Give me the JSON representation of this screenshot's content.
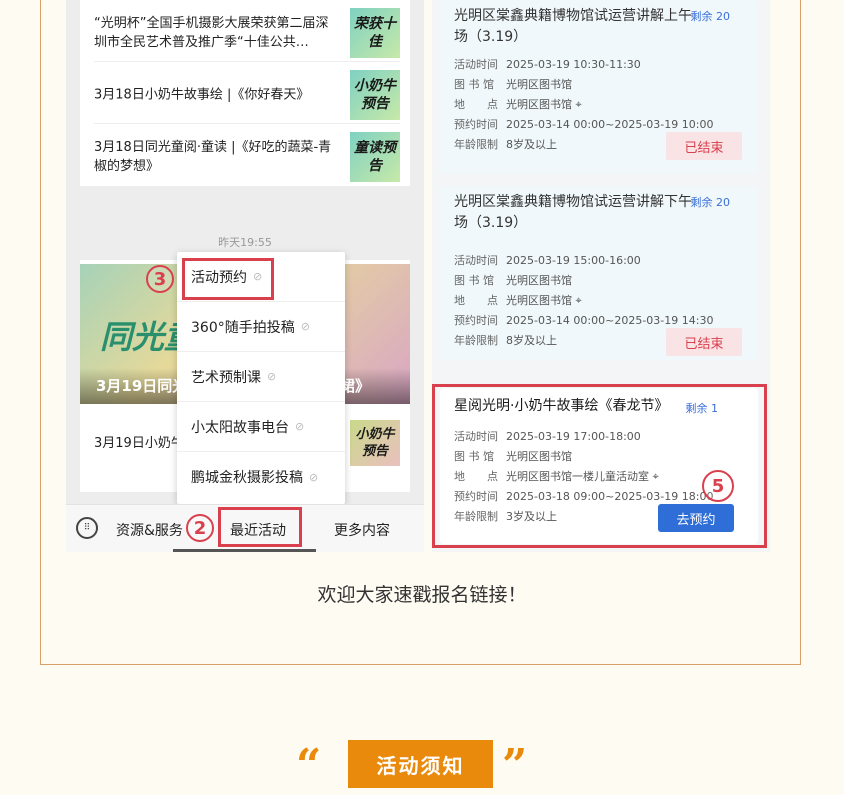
{
  "left_screen": {
    "news": [
      {
        "text": "“光明杯”全国手机摄影大展荣获第二届深圳市全民艺术普及推广季“十佳公共…",
        "thumb": "荣获十佳"
      },
      {
        "text": "3月18日小奶牛故事绘 |《你好春天》",
        "thumb": "小奶牛预告"
      },
      {
        "text": "3月18日同光童阅·童读 |《好吃的蔬菜-青椒的梦想》",
        "thumb": "童读预告"
      }
    ],
    "time_label": "昨天19:55",
    "banner_big": "同光童",
    "banner_title": "3月19日同光",
    "banner_right": "围裙》",
    "row2_text": "3月19日小奶牛",
    "row2_thumb": "小奶牛预告",
    "popup_items": [
      "活动预约",
      "360°随手拍投稿",
      "艺术预制课",
      "小太阳故事电台",
      "鹏城金秋摄影投稿"
    ],
    "bottom_menu": {
      "keyboard_icon": "keyboard-icon",
      "resources": "资源&服务",
      "recent": "最近活动",
      "more": "更多内容"
    },
    "markers": {
      "m2": "2",
      "m3": "3"
    }
  },
  "right_screen": {
    "labels": {
      "time": "活动时间",
      "lib": "图 书 馆",
      "addr": "地　　点",
      "book": "预约时间",
      "age": "年龄限制"
    },
    "activities": [
      {
        "title": "光明区棠鑫典籍博物馆试运营讲解上午场（3.19）",
        "remaining": "剩余 20",
        "time": "2025-03-19 10:30-11:30",
        "library": "光明区图书馆",
        "location": "光明区图书馆",
        "booking": "2025-03-14 00:00~2025-03-19 10:00",
        "age": "8岁及以上",
        "status": "已结束"
      },
      {
        "title": "光明区棠鑫典籍博物馆试运营讲解下午场（3.19）",
        "remaining": "剩余 20",
        "time": "2025-03-19 15:00-16:00",
        "library": "光明区图书馆",
        "location": "光明区图书馆",
        "booking": "2025-03-14 00:00~2025-03-19 14:30",
        "age": "8岁及以上",
        "status": "已结束"
      },
      {
        "title": "星阅光明·小奶牛故事绘《春龙节》",
        "remaining": "剩余 1",
        "time": "2025-03-19 17:00-18:00",
        "library": "光明区图书馆",
        "location": "光明区图书馆一楼儿童活动室",
        "booking": "2025-03-18 09:00~2025-03-19 18:00",
        "age": "3岁及以上",
        "status": "去预约"
      }
    ],
    "marker5": "5"
  },
  "caption": "欢迎大家速戳报名链接！",
  "notice": {
    "label": "活动须知",
    "quote_open": "“",
    "quote_close": "”"
  },
  "colors": {
    "accent": "#ea8a0c",
    "highlight": "#d9404e",
    "book_btn": "#2e6ed6"
  }
}
